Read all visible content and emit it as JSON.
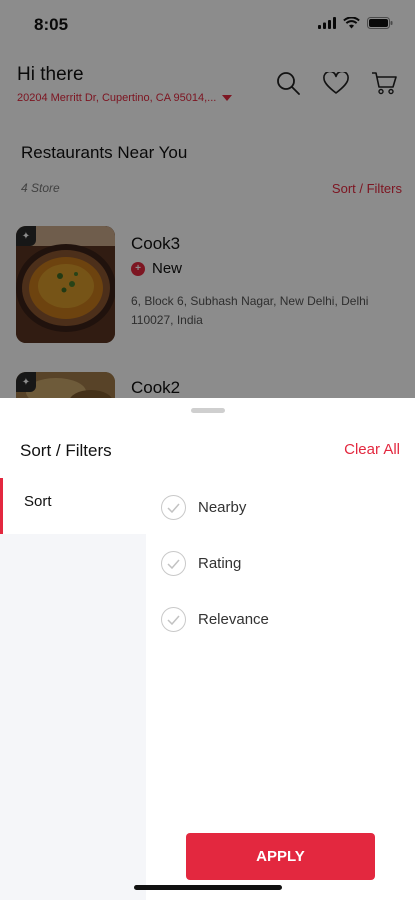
{
  "status_bar": {
    "time": "8:05"
  },
  "header": {
    "greeting": "Hi there",
    "address": "20204 Merritt Dr, Cupertino, CA  95014,..."
  },
  "section": {
    "title": "Restaurants Near You",
    "store_count": "4 Store",
    "sort_link": "Sort / Filters"
  },
  "restaurants": [
    {
      "name": "Cook3",
      "status": "New",
      "address": "6, Block 6, Subhash Nagar, New Delhi, Delhi 110027, India"
    },
    {
      "name": "Cook2"
    }
  ],
  "sheet": {
    "title": "Sort / Filters",
    "clear_all": "Clear All",
    "tabs": [
      {
        "label": "Sort"
      }
    ],
    "options": [
      {
        "label": "Nearby"
      },
      {
        "label": "Rating"
      },
      {
        "label": "Relevance"
      }
    ],
    "apply": "APPLY"
  },
  "colors": {
    "accent": "#e3283f",
    "side_panel": "#f5f6f9",
    "overlay": "rgba(0,0,0,0.45)"
  },
  "icons": {
    "header": [
      "search-icon",
      "heart-icon",
      "cart-icon"
    ],
    "status": [
      "signal-icon",
      "wifi-icon",
      "battery-icon"
    ]
  }
}
